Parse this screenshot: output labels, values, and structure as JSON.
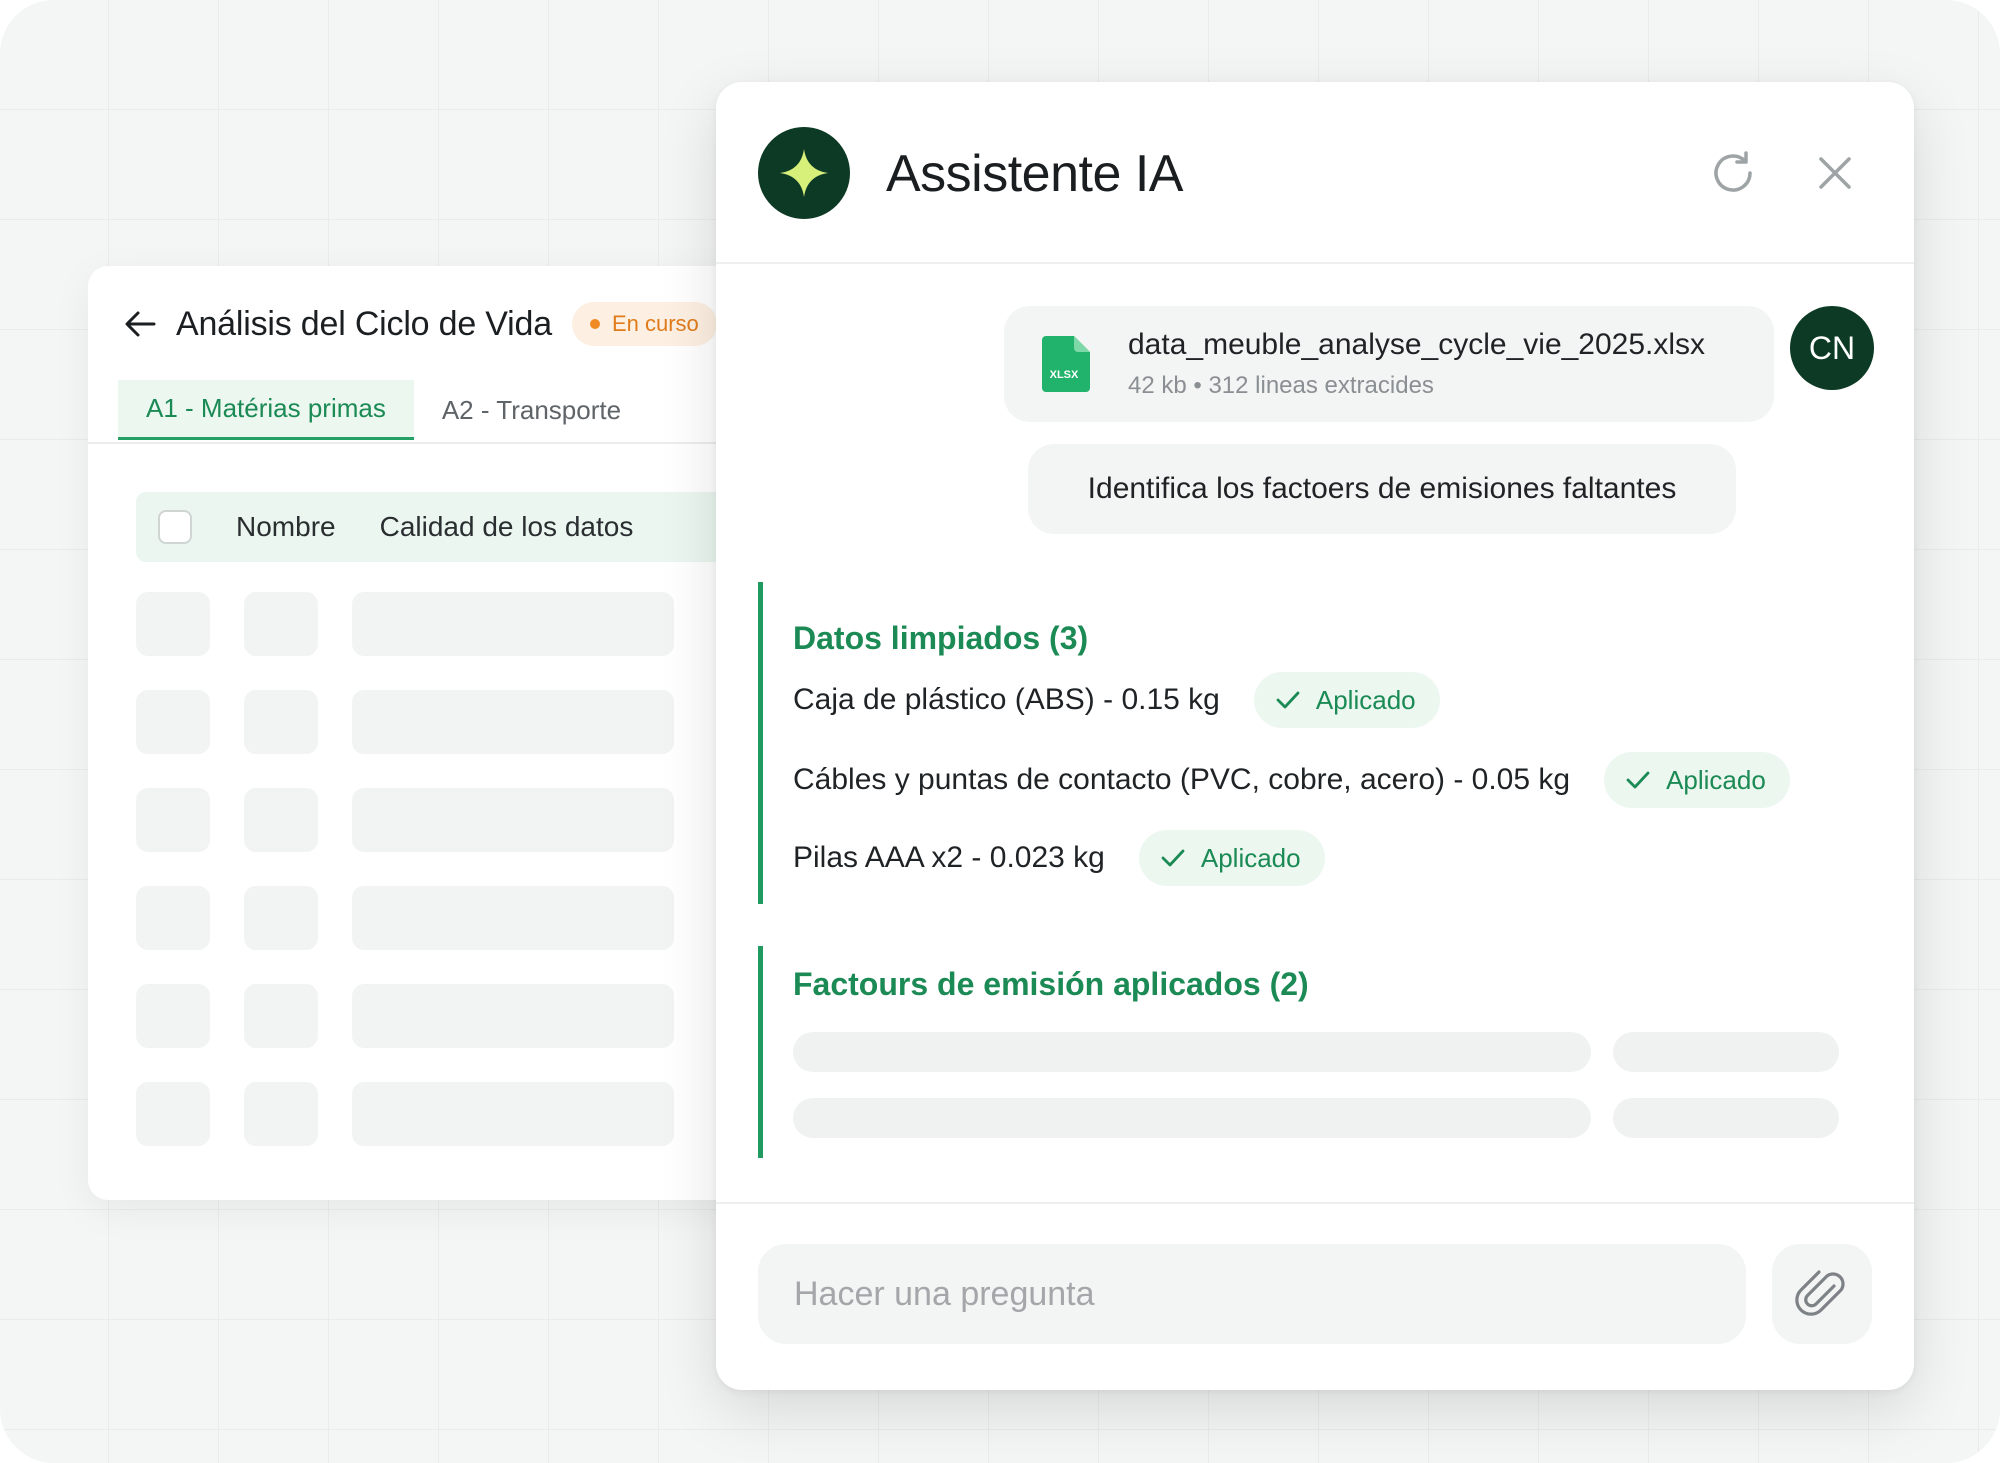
{
  "background_panel": {
    "title": "Análisis del Ciclo de Vida",
    "status": "En curso",
    "tabs": [
      {
        "label": "A1 - Matérias primas",
        "active": true
      },
      {
        "label": "A2 - Transporte",
        "active": false
      }
    ],
    "table_headers": {
      "name": "Nombre",
      "quality": "Calidad de los datos"
    }
  },
  "assistant": {
    "title": "Assistente IA",
    "icons": {
      "logo": "sparkle-icon",
      "refresh": "refresh-icon",
      "close": "close-icon",
      "attach": "paperclip-icon",
      "file": "xlsx-file-icon"
    },
    "file": {
      "name": "data_meuble_analyse_cycle_vie_2025.xlsx",
      "meta": "42 kb • 312 lineas extracides",
      "type_label": "XLSX"
    },
    "user_initials": "CN",
    "user_message": "Identifica los factoers de emisiones faltantes",
    "cleaned_section": {
      "title": "Datos limpiados (3)",
      "items": [
        {
          "text": "Caja de plástico (ABS) - 0.15 kg",
          "status": "Aplicado"
        },
        {
          "text": "Cábles y puntas de contacto (PVC, cobre, acero) - 0.05 kg",
          "status": "Aplicado"
        },
        {
          "text": "Pilas AAA x2 - 0.023 kg",
          "status": "Aplicado"
        }
      ]
    },
    "factors_section": {
      "title": "Factours de emisión aplicados (2)"
    },
    "input": {
      "placeholder": "Hacer una pregunta",
      "value": ""
    }
  },
  "colors": {
    "brand_dark": "#0d3a25",
    "accent_green": "#1b8a55",
    "badge_bg": "#ecf7f0",
    "status_orange": "#e07b1c"
  }
}
